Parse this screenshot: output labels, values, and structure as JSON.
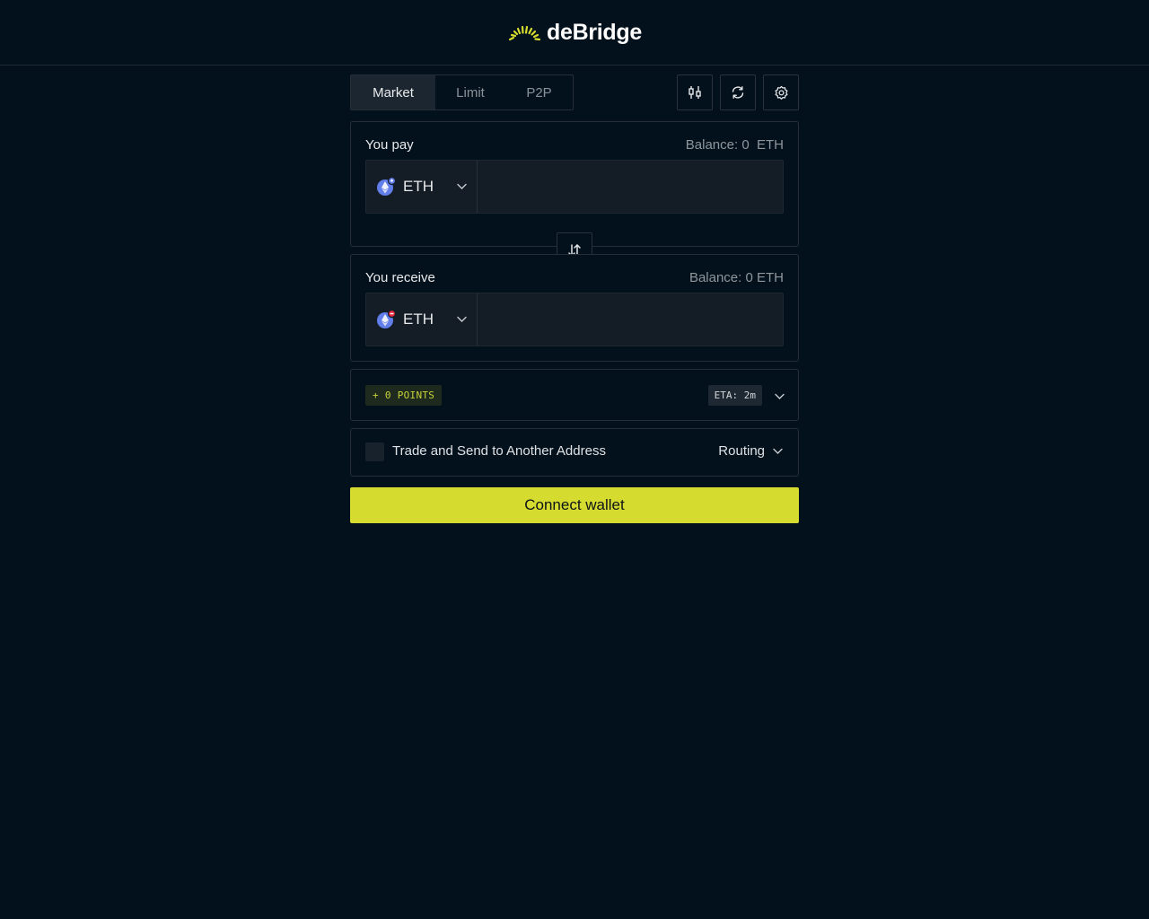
{
  "header": {
    "brand": "deBridge"
  },
  "tabs": [
    {
      "label": "Market",
      "active": true
    },
    {
      "label": "Limit",
      "active": false
    },
    {
      "label": "P2P",
      "active": false
    }
  ],
  "toolbar": {
    "icons": [
      "chart-candles-icon",
      "refresh-icon",
      "settings-icon"
    ]
  },
  "pay": {
    "label": "You pay",
    "balance": "Balance: 0  ETH",
    "token": "ETH",
    "amount": "",
    "chain_badge_color": "#627eea"
  },
  "receive": {
    "label": "You receive",
    "balance": "Balance: 0 ETH",
    "token": "ETH",
    "amount": "",
    "chain_badge_color": "#e8283c"
  },
  "info": {
    "points": "+ 0 POINTS",
    "eta": "ETA: 2m"
  },
  "options": {
    "send_to_address_label": "Trade and Send to Another Address",
    "routing_label": "Routing"
  },
  "connect_button": "Connect wallet",
  "colors": {
    "background": "#03111c",
    "accent": "#d5dc2f",
    "panel_border": "#262f37"
  }
}
